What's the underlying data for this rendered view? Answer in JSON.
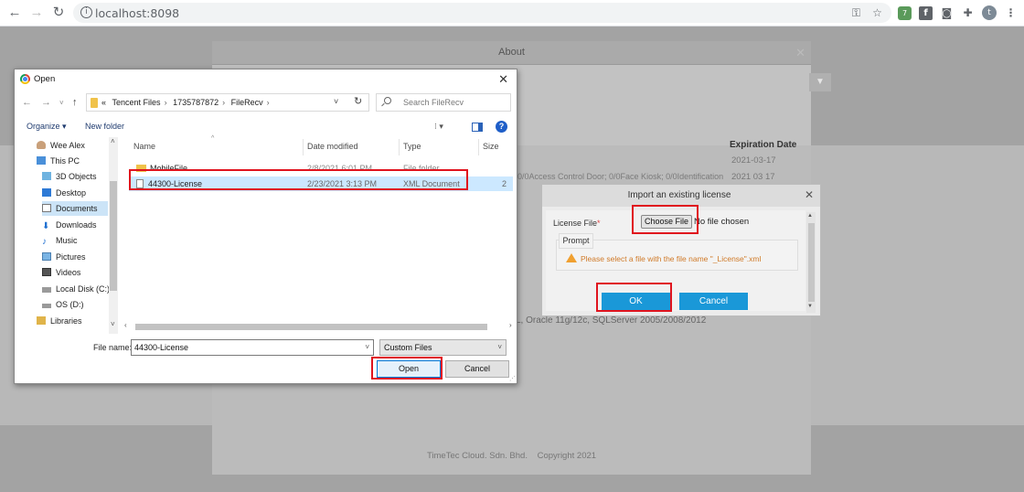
{
  "browser": {
    "url": "localhost:8098",
    "profile_initial": "t",
    "extension_badge": "7",
    "colors": {
      "toolbar_bg": "#ffffff",
      "url_bg": "#f1f3f4"
    }
  },
  "about_dialog": {
    "title": "About",
    "expiration_header": "Expiration Date",
    "expiration_dates": [
      "2021-03-17",
      "2021 03 17"
    ],
    "modules_text": "0/0Access Control Door; 0/0Face Kiosk; 0/0Identification",
    "database_text": "L, Oracle 11g/12c, SQLServer 2005/2008/2012",
    "footer_company": "TimeTec Cloud. Sdn. Bhd.",
    "footer_copyright": "Copyright 2021"
  },
  "import_dialog": {
    "title": "Import an existing license",
    "license_label": "License File",
    "required_mark": "*",
    "choose_file_label": "Choose File",
    "file_status": "No file chosen",
    "prompt_label": "Prompt",
    "prompt_message": "Please select a file with the file name \"_License\".xml",
    "ok_label": "OK",
    "cancel_label": "Cancel",
    "colors": {
      "button": "#1a98d8",
      "warning": "#f0a030"
    }
  },
  "open_dialog": {
    "title": "Open",
    "breadcrumb": [
      "Tencent Files",
      "1735787872",
      "FileRecv"
    ],
    "breadcrumb_prefix": "«",
    "search_placeholder": "Search FileRecv",
    "organize_label": "Organize ▾",
    "new_folder_label": "New folder",
    "nav_items": [
      {
        "label": "Wee Alex",
        "icon": "user-icon"
      },
      {
        "label": "This PC",
        "icon": "computer-icon"
      },
      {
        "label": "3D Objects",
        "icon": "cube-icon"
      },
      {
        "label": "Desktop",
        "icon": "desktop-icon"
      },
      {
        "label": "Documents",
        "icon": "documents-icon",
        "selected": true
      },
      {
        "label": "Downloads",
        "icon": "download-icon"
      },
      {
        "label": "Music",
        "icon": "music-icon"
      },
      {
        "label": "Pictures",
        "icon": "pictures-icon"
      },
      {
        "label": "Videos",
        "icon": "videos-icon"
      },
      {
        "label": "Local Disk (C:)",
        "icon": "disk-icon"
      },
      {
        "label": "OS (D:)",
        "icon": "disk-icon"
      },
      {
        "label": "Libraries",
        "icon": "libraries-icon"
      }
    ],
    "columns": {
      "name": "Name",
      "date": "Date modified",
      "type": "Type",
      "size": "Size"
    },
    "files": [
      {
        "name": "MobileFile",
        "date": "2/8/2021 6:01 PM",
        "type": "File folder",
        "size": "",
        "icon": "folder-icon"
      },
      {
        "name": "44300-License",
        "date": "2/23/2021 3:13 PM",
        "type": "XML Document",
        "size": "2",
        "icon": "xml-document-icon",
        "selected": true
      }
    ],
    "file_name_label": "File name:",
    "file_name_value": "44300-License",
    "file_type_value": "Custom Files",
    "open_label": "Open",
    "cancel_label": "Cancel"
  }
}
